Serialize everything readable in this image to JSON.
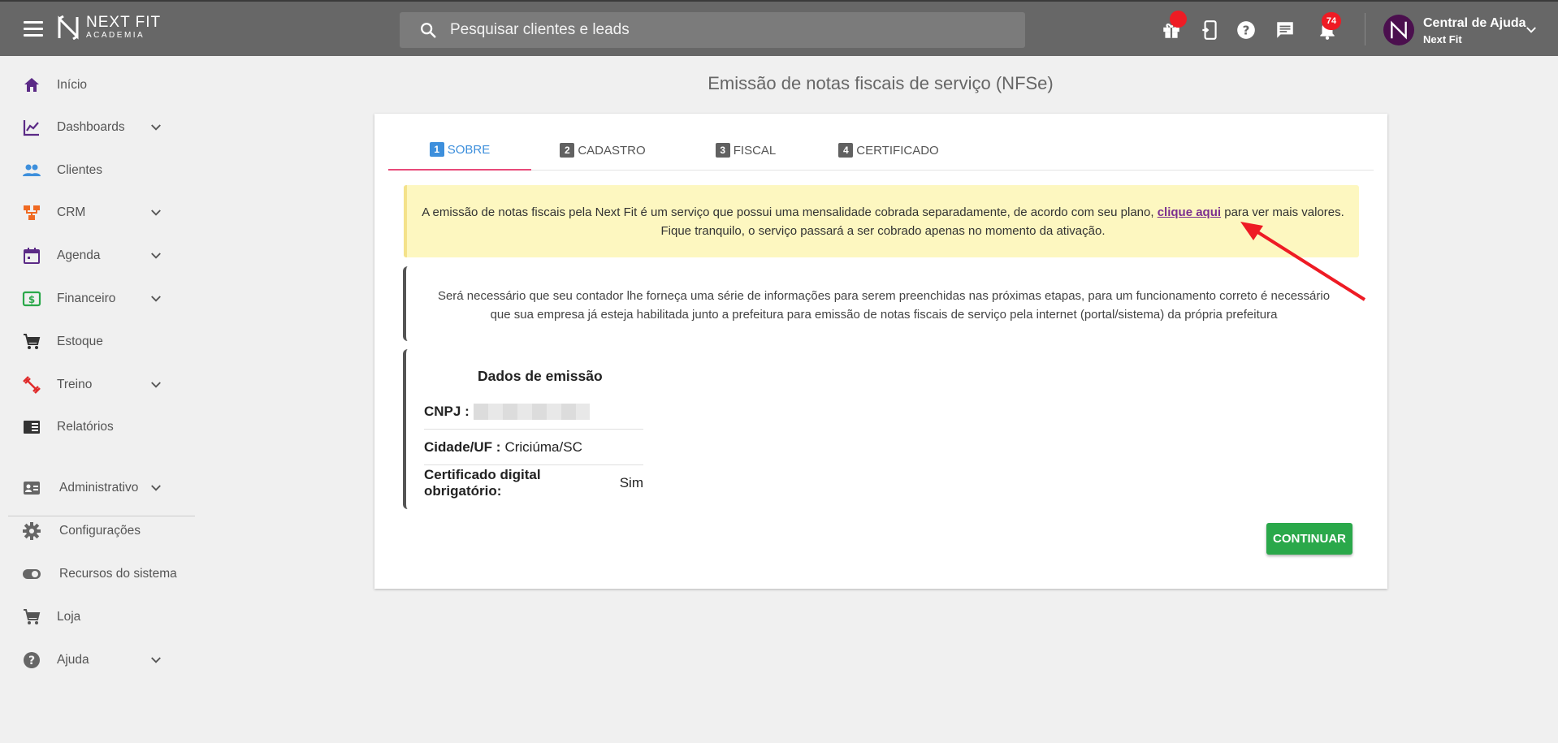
{
  "header": {
    "logo_line1": "NEXT FIT",
    "logo_line2": "ACADEMIA",
    "search_placeholder": "Pesquisar clientes e leads",
    "notification_count": "74",
    "user_name": "Central de Ajuda",
    "user_org": "Next Fit"
  },
  "sidebar": {
    "items": [
      {
        "label": "Início",
        "icon": "home-icon",
        "color": "#5b2a86"
      },
      {
        "label": "Dashboards",
        "icon": "chart-line-icon",
        "color": "#5b2a86"
      },
      {
        "label": "Clientes",
        "icon": "people-icon",
        "color": "#3d8fdc"
      },
      {
        "label": "CRM",
        "icon": "crm-icon",
        "color": "#f06a22"
      },
      {
        "label": "Agenda",
        "icon": "calendar-icon",
        "color": "#5b2a86"
      },
      {
        "label": "Financeiro",
        "icon": "money-icon",
        "color": "#2aa84a"
      },
      {
        "label": "Estoque",
        "icon": "cart-icon",
        "color": "#333333"
      },
      {
        "label": "Treino",
        "icon": "dumbbell-icon",
        "color": "#e02b2b"
      },
      {
        "label": "Relatórios",
        "icon": "reports-icon",
        "color": "#333333"
      },
      {
        "label": "Administrativo",
        "icon": "id-card-icon",
        "color": "#666666"
      },
      {
        "label": "Configurações",
        "icon": "gear-icon",
        "color": "#666666"
      },
      {
        "label": "Recursos do sistema",
        "icon": "toggle-icon",
        "color": "#666666"
      },
      {
        "label": "Loja",
        "icon": "cart-icon",
        "color": "#555555"
      },
      {
        "label": "Ajuda",
        "icon": "help-icon",
        "color": "#666666"
      }
    ]
  },
  "main": {
    "title": "Emissão de notas fiscais de serviço (NFSe)",
    "tabs": [
      {
        "num": "1",
        "label": "SOBRE"
      },
      {
        "num": "2",
        "label": "CADASTRO"
      },
      {
        "num": "3",
        "label": "FISCAL"
      },
      {
        "num": "4",
        "label": "CERTIFICADO"
      }
    ],
    "notice_before": "A emissão de notas fiscais pela Next Fit é um serviço que possui uma mensalidade cobrada separadamente, de acordo com seu plano,",
    "notice_link": "clique aqui",
    "notice_after": "para ver mais valores. Fique tranquilo, o serviço passará a ser cobrado apenas no momento da ativação.",
    "info_text": "Será necessário que seu contador lhe forneça uma série de informações para serem preenchidas nas próximas etapas, para um funcionamento correto é necessário que sua empresa já esteja habilitada junto a prefeitura para emissão de notas fiscais de serviço pela internet (portal/sistema) da própria prefeitura",
    "data_title": "Dados de emissão",
    "cnpj_label": "CNPJ :",
    "cidade_label": "Cidade/UF :",
    "cidade_value": "Criciúma/SC",
    "cert_label": "Certificado digital obrigatório:",
    "cert_value": "Sim",
    "continue_label": "CONTINUAR"
  },
  "colors": {
    "topbar": "#676767",
    "accent_blue": "#3d8fdc",
    "tab_underline": "#e84a7a",
    "notice_bg": "#fdf7c0",
    "link": "#7b2f8f",
    "continue": "#2aa84a",
    "annotation_arrow": "#ee1b24"
  }
}
